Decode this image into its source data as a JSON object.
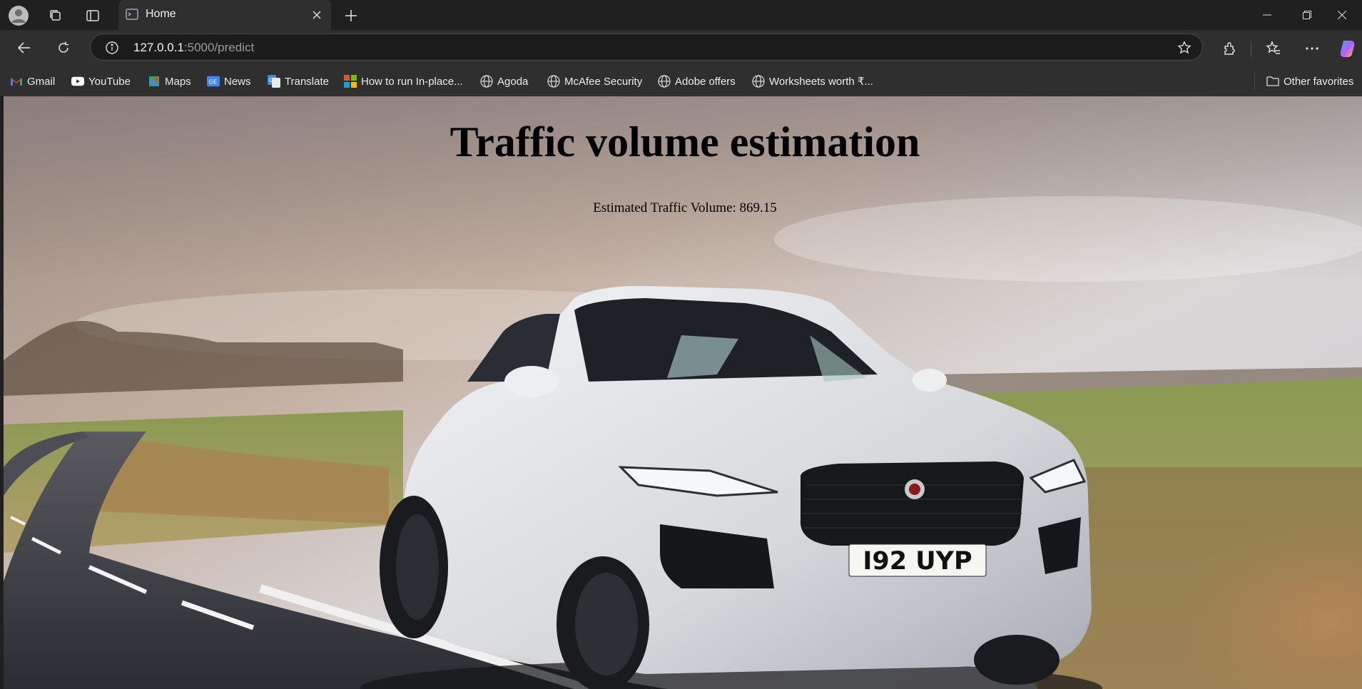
{
  "browser": {
    "tab": {
      "title": "Home"
    },
    "address": {
      "host": "127.0.0.1",
      "path": ":5000/predict"
    },
    "favorites": [
      {
        "label": "Gmail",
        "icon": "gmail-icon"
      },
      {
        "label": "YouTube",
        "icon": "youtube-icon"
      },
      {
        "label": "Maps",
        "icon": "maps-icon"
      },
      {
        "label": "News",
        "icon": "news-icon"
      },
      {
        "label": "Translate",
        "icon": "translate-icon"
      },
      {
        "label": "How to run In-place...",
        "icon": "microsoft-icon"
      },
      {
        "label": "Agoda",
        "icon": "globe-icon"
      },
      {
        "label": "McAfee Security",
        "icon": "globe-icon"
      },
      {
        "label": "Adobe offers",
        "icon": "globe-icon"
      },
      {
        "label": "Worksheets worth ₹...",
        "icon": "globe-icon"
      }
    ],
    "other_favorites": "Other favorites"
  },
  "page": {
    "title": "Traffic volume estimation",
    "result": "Estimated Traffic Volume: 869.15",
    "plate": "I92 UYP"
  }
}
